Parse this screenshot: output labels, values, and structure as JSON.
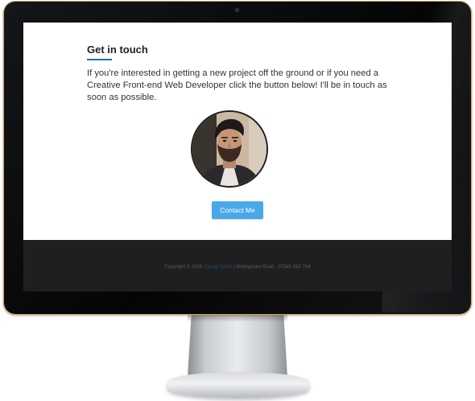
{
  "section": {
    "heading": "Get in touch",
    "intro": "If you're interested in getting a new project off the ground or if you need a Creative Front-end Web Developer click the button below! I'll be in touch as soon as possible."
  },
  "profile": {
    "photo": "profile-photo"
  },
  "cta": {
    "label": "Contact Me"
  },
  "footer": {
    "copyright": "Copyright © 2016,",
    "name_link": "Daniel Smith",
    "address": "| Nottingham Road · 07545 850 764"
  },
  "colors": {
    "accent": "#4aa8e8",
    "heading_rule": "#1f6fa8",
    "footer_bg": "#1f1f1f",
    "monitor_bezel": "#0a0a0c"
  }
}
